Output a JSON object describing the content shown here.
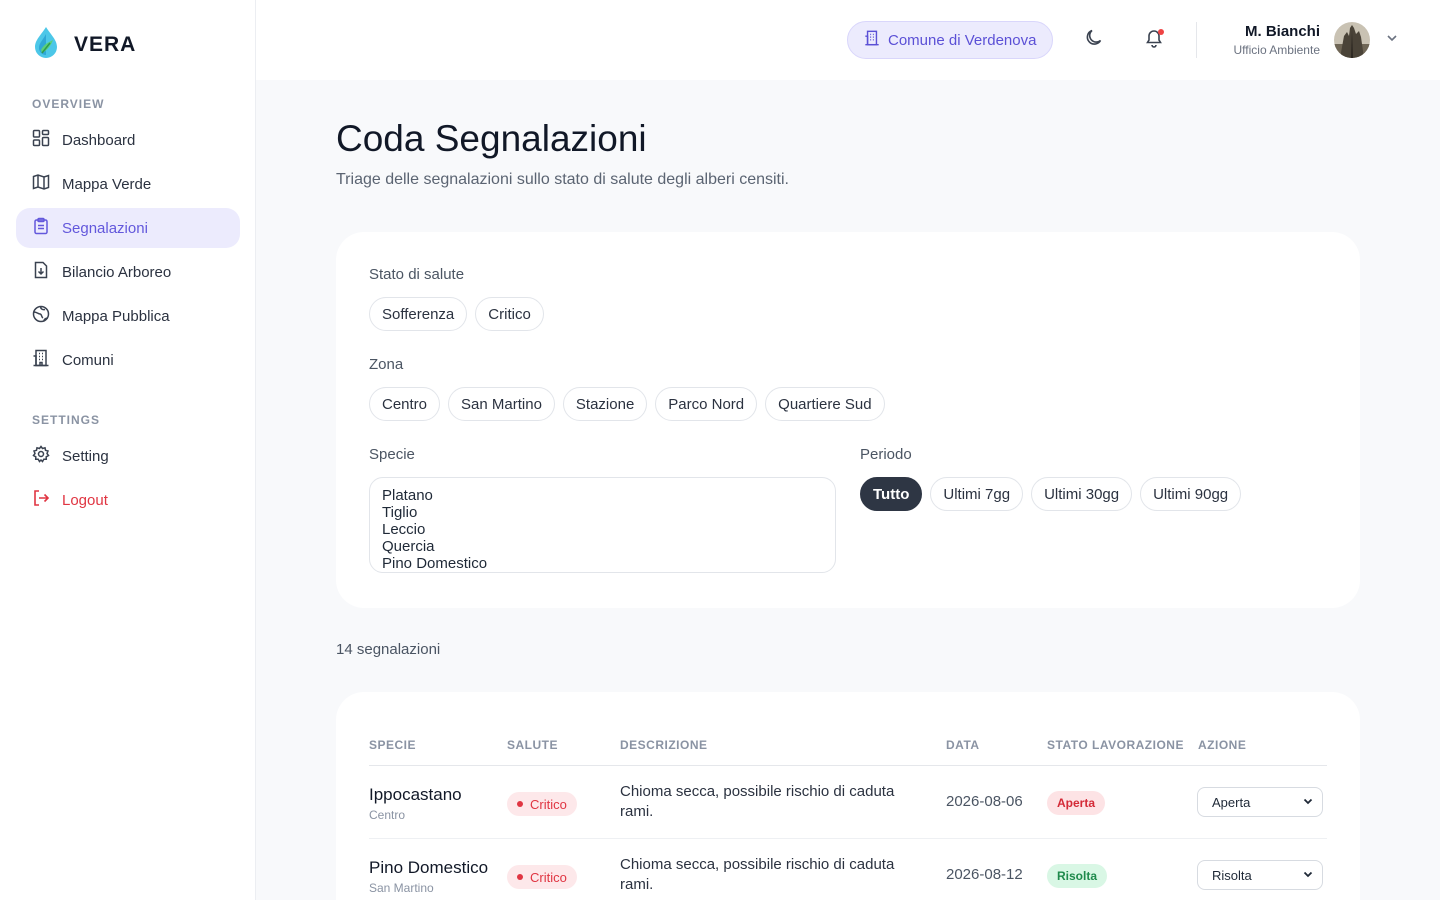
{
  "brand": {
    "name": "VERA"
  },
  "sidebar": {
    "sections": [
      {
        "title": "OVERVIEW"
      },
      {
        "title": "SETTINGS"
      }
    ],
    "items": [
      {
        "label": "Dashboard",
        "icon": "dashboard-icon"
      },
      {
        "label": "Mappa Verde",
        "icon": "map-icon"
      },
      {
        "label": "Segnalazioni",
        "icon": "clipboard-icon",
        "active": true
      },
      {
        "label": "Bilancio Arboreo",
        "icon": "file-download-icon"
      },
      {
        "label": "Mappa Pubblica",
        "icon": "globe-icon"
      },
      {
        "label": "Comuni",
        "icon": "building-icon"
      },
      {
        "label": "Setting",
        "icon": "gear-icon"
      },
      {
        "label": "Logout",
        "icon": "logout-icon"
      }
    ]
  },
  "topbar": {
    "comune": "Comune di Verdenova",
    "user_name": "M. Bianchi",
    "user_role": "Ufficio Ambiente"
  },
  "page": {
    "title": "Coda Segnalazioni",
    "subtitle": "Triage delle segnalazioni sullo stato di salute degli alberi censiti."
  },
  "filters": {
    "health_label": "Stato di salute",
    "health_options": [
      "Sofferenza",
      "Critico"
    ],
    "zone_label": "Zona",
    "zone_options": [
      "Centro",
      "San Martino",
      "Stazione",
      "Parco Nord",
      "Quartiere Sud"
    ],
    "species_label": "Specie",
    "species_options": [
      "Platano",
      "Tiglio",
      "Leccio",
      "Quercia",
      "Pino Domestico"
    ],
    "period_label": "Periodo",
    "period_options": [
      "Tutto",
      "Ultimi 7gg",
      "Ultimi 30gg",
      "Ultimi 90gg"
    ],
    "period_selected": "Tutto"
  },
  "count_label": "14 segnalazioni",
  "table": {
    "headers": [
      "SPECIE",
      "SALUTE",
      "DESCRIZIONE",
      "DATA",
      "STATO LAVORAZIONE",
      "AZIONE"
    ],
    "rows": [
      {
        "species": "Ippocastano",
        "zone": "Centro",
        "health": "Critico",
        "description": "Chioma secca, possibile rischio di caduta rami.",
        "date": "2026-08-06",
        "status": "Aperta",
        "action": "Aperta"
      },
      {
        "species": "Pino Domestico",
        "zone": "San Martino",
        "health": "Critico",
        "description": "Chioma secca, possibile rischio di caduta rami.",
        "date": "2026-08-12",
        "status": "Risolta",
        "action": "Risolta"
      }
    ]
  },
  "colors": {
    "accent": "#6358dc",
    "danger": "#e03542",
    "success": "#1f8a4c",
    "dark_chip": "#2e3644"
  }
}
